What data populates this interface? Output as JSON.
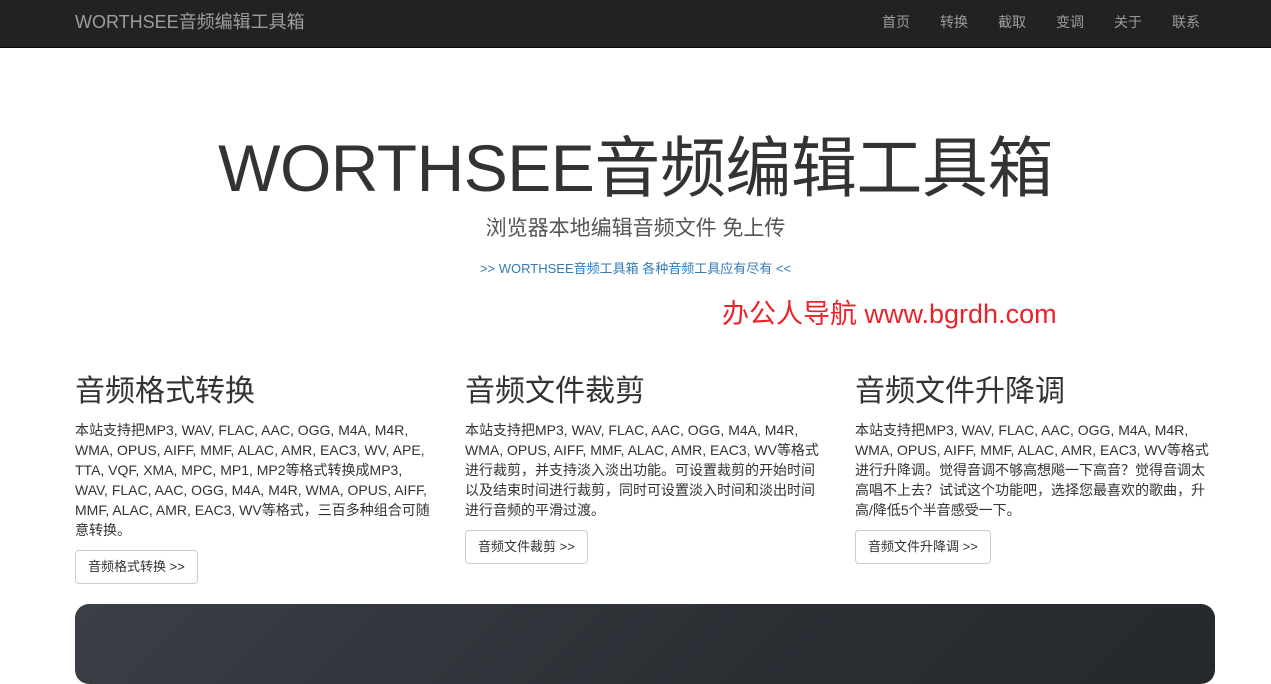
{
  "navbar": {
    "brand": "WORTHSEE音频编辑工具箱",
    "items": [
      {
        "label": "首页"
      },
      {
        "label": "转换"
      },
      {
        "label": "截取"
      },
      {
        "label": "变调"
      },
      {
        "label": "关于"
      },
      {
        "label": "联系"
      }
    ]
  },
  "hero": {
    "title": "WORTHSEE音频编辑工具箱",
    "subtitle": "浏览器本地编辑音频文件 免上传",
    "link": ">> WORTHSEE音频工具箱 各种音频工具应有尽有 <<"
  },
  "watermark": "办公人导航 www.bgrdh.com",
  "features": [
    {
      "title": "音频格式转换",
      "description": "本站支持把MP3, WAV, FLAC, AAC, OGG, M4A, M4R, WMA, OPUS, AIFF, MMF, ALAC, AMR, EAC3, WV, APE, TTA, VQF, XMA, MPC, MP1, MP2等格式转换成MP3, WAV, FLAC, AAC, OGG, M4A, M4R, WMA, OPUS, AIFF, MMF, ALAC, AMR, EAC3, WV等格式，三百多种组合可随意转换。",
      "button": "音频格式转换 >>"
    },
    {
      "title": "音频文件裁剪",
      "description": "本站支持把MP3, WAV, FLAC, AAC, OGG, M4A, M4R, WMA, OPUS, AIFF, MMF, ALAC, AMR, EAC3, WV等格式进行裁剪，并支持淡入淡出功能。可设置裁剪的开始时间以及结束时间进行裁剪，同时可设置淡入时间和淡出时间进行音频的平滑过渡。",
      "button": "音频文件裁剪 >>"
    },
    {
      "title": "音频文件升降调",
      "description": "本站支持把MP3, WAV, FLAC, AAC, OGG, M4A, M4R, WMA, OPUS, AIFF, MMF, ALAC, AMR, EAC3, WV等格式进行升降调。觉得音调不够高想飚一下高音？觉得音调太高唱不上去？试试这个功能吧，选择您最喜欢的歌曲，升高/降低5个半音感受一下。",
      "button": "音频文件升降调 >>"
    }
  ],
  "colors": {
    "navbar_bg": "#222222",
    "nav_text": "#9d9d9d",
    "link": "#337ab7",
    "watermark": "#e8232a"
  }
}
